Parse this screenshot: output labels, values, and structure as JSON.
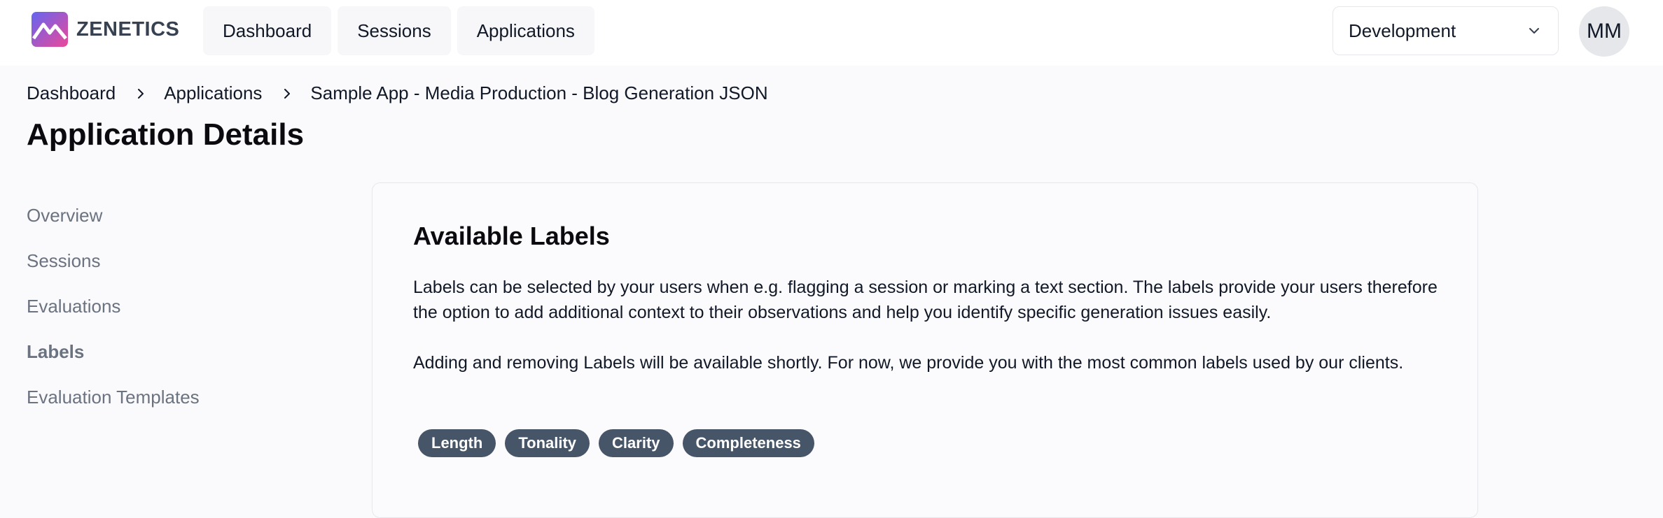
{
  "brand": {
    "name": "ZENETICS",
    "logo_icon": "mountain-logo-icon",
    "logo_gradient": [
      "#6366f1",
      "#ec4899"
    ]
  },
  "nav": {
    "items": [
      {
        "label": "Dashboard"
      },
      {
        "label": "Sessions"
      },
      {
        "label": "Applications"
      }
    ]
  },
  "environment": {
    "selected": "Development",
    "icon": "chevron-down-icon"
  },
  "user": {
    "initials": "MM"
  },
  "breadcrumb": {
    "items": [
      {
        "label": "Dashboard"
      },
      {
        "label": "Applications"
      },
      {
        "label": "Sample App - Media Production - Blog Generation JSON"
      }
    ],
    "separator_icon": "chevron-right-icon"
  },
  "page": {
    "title": "Application Details"
  },
  "sidenav": {
    "items": [
      {
        "label": "Overview"
      },
      {
        "label": "Sessions"
      },
      {
        "label": "Evaluations"
      },
      {
        "label": "Labels",
        "active": true
      },
      {
        "label": "Evaluation Templates"
      }
    ]
  },
  "card": {
    "title": "Available Labels",
    "paragraph1": "Labels can be selected by your users when e.g. flagging a session or marking a text section. The labels provide your users therefore the option to add additional context to their observations and help you identify specific generation issues easily.",
    "paragraph2": "Adding and removing Labels will be available shortly. For now, we provide you with the most common labels used by our clients.",
    "labels": [
      {
        "label": "Length"
      },
      {
        "label": "Tonality"
      },
      {
        "label": "Clarity"
      },
      {
        "label": "Completeness"
      }
    ]
  },
  "colors": {
    "background": "#fafafc",
    "chip": "#475569",
    "muted_text": "#6b7280"
  }
}
